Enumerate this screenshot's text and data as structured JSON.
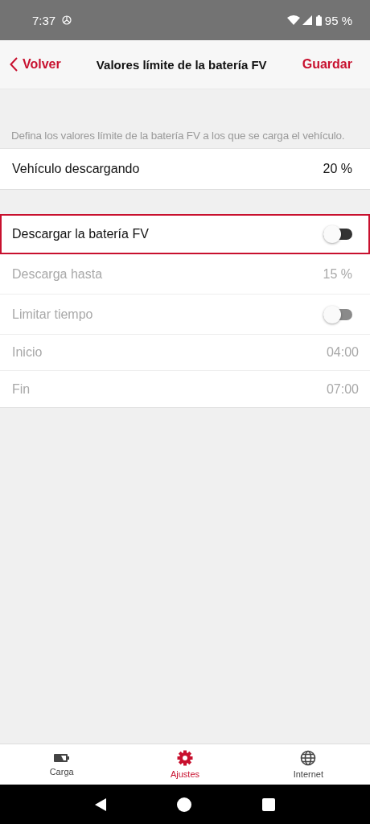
{
  "status_bar": {
    "time": "7:37",
    "battery": "95 %"
  },
  "header": {
    "back": "Volver",
    "title": "Valores límite de la batería FV",
    "action": "Guardar"
  },
  "description": "Defina los valores límite de la batería FV a los que se carga el vehículo.",
  "groups": [
    {
      "rows": [
        {
          "kind": "value",
          "label": "Vehículo descargando",
          "value": "20 %",
          "disabled": false,
          "highlighted": false
        }
      ]
    },
    {
      "rows": [
        {
          "kind": "toggle",
          "label": "Descargar la batería FV",
          "on": false,
          "disabled": false,
          "highlighted": true
        },
        {
          "kind": "value",
          "label": "Descarga hasta",
          "value": "15 %",
          "disabled": true,
          "highlighted": false
        },
        {
          "kind": "toggle",
          "label": "Limitar tiempo",
          "on": false,
          "disabled": true,
          "highlighted": false
        },
        {
          "kind": "time",
          "label": "Inicio",
          "value": "04:00",
          "disabled": true,
          "highlighted": false
        },
        {
          "kind": "time",
          "label": "Fin",
          "value": "07:00",
          "disabled": true,
          "highlighted": false
        }
      ]
    }
  ],
  "tabs": [
    {
      "label": "Carga",
      "kind": "battery",
      "selected": false
    },
    {
      "label": "Ajustes",
      "kind": "gear",
      "selected": true
    },
    {
      "label": "Internet",
      "kind": "globe",
      "selected": false
    }
  ]
}
